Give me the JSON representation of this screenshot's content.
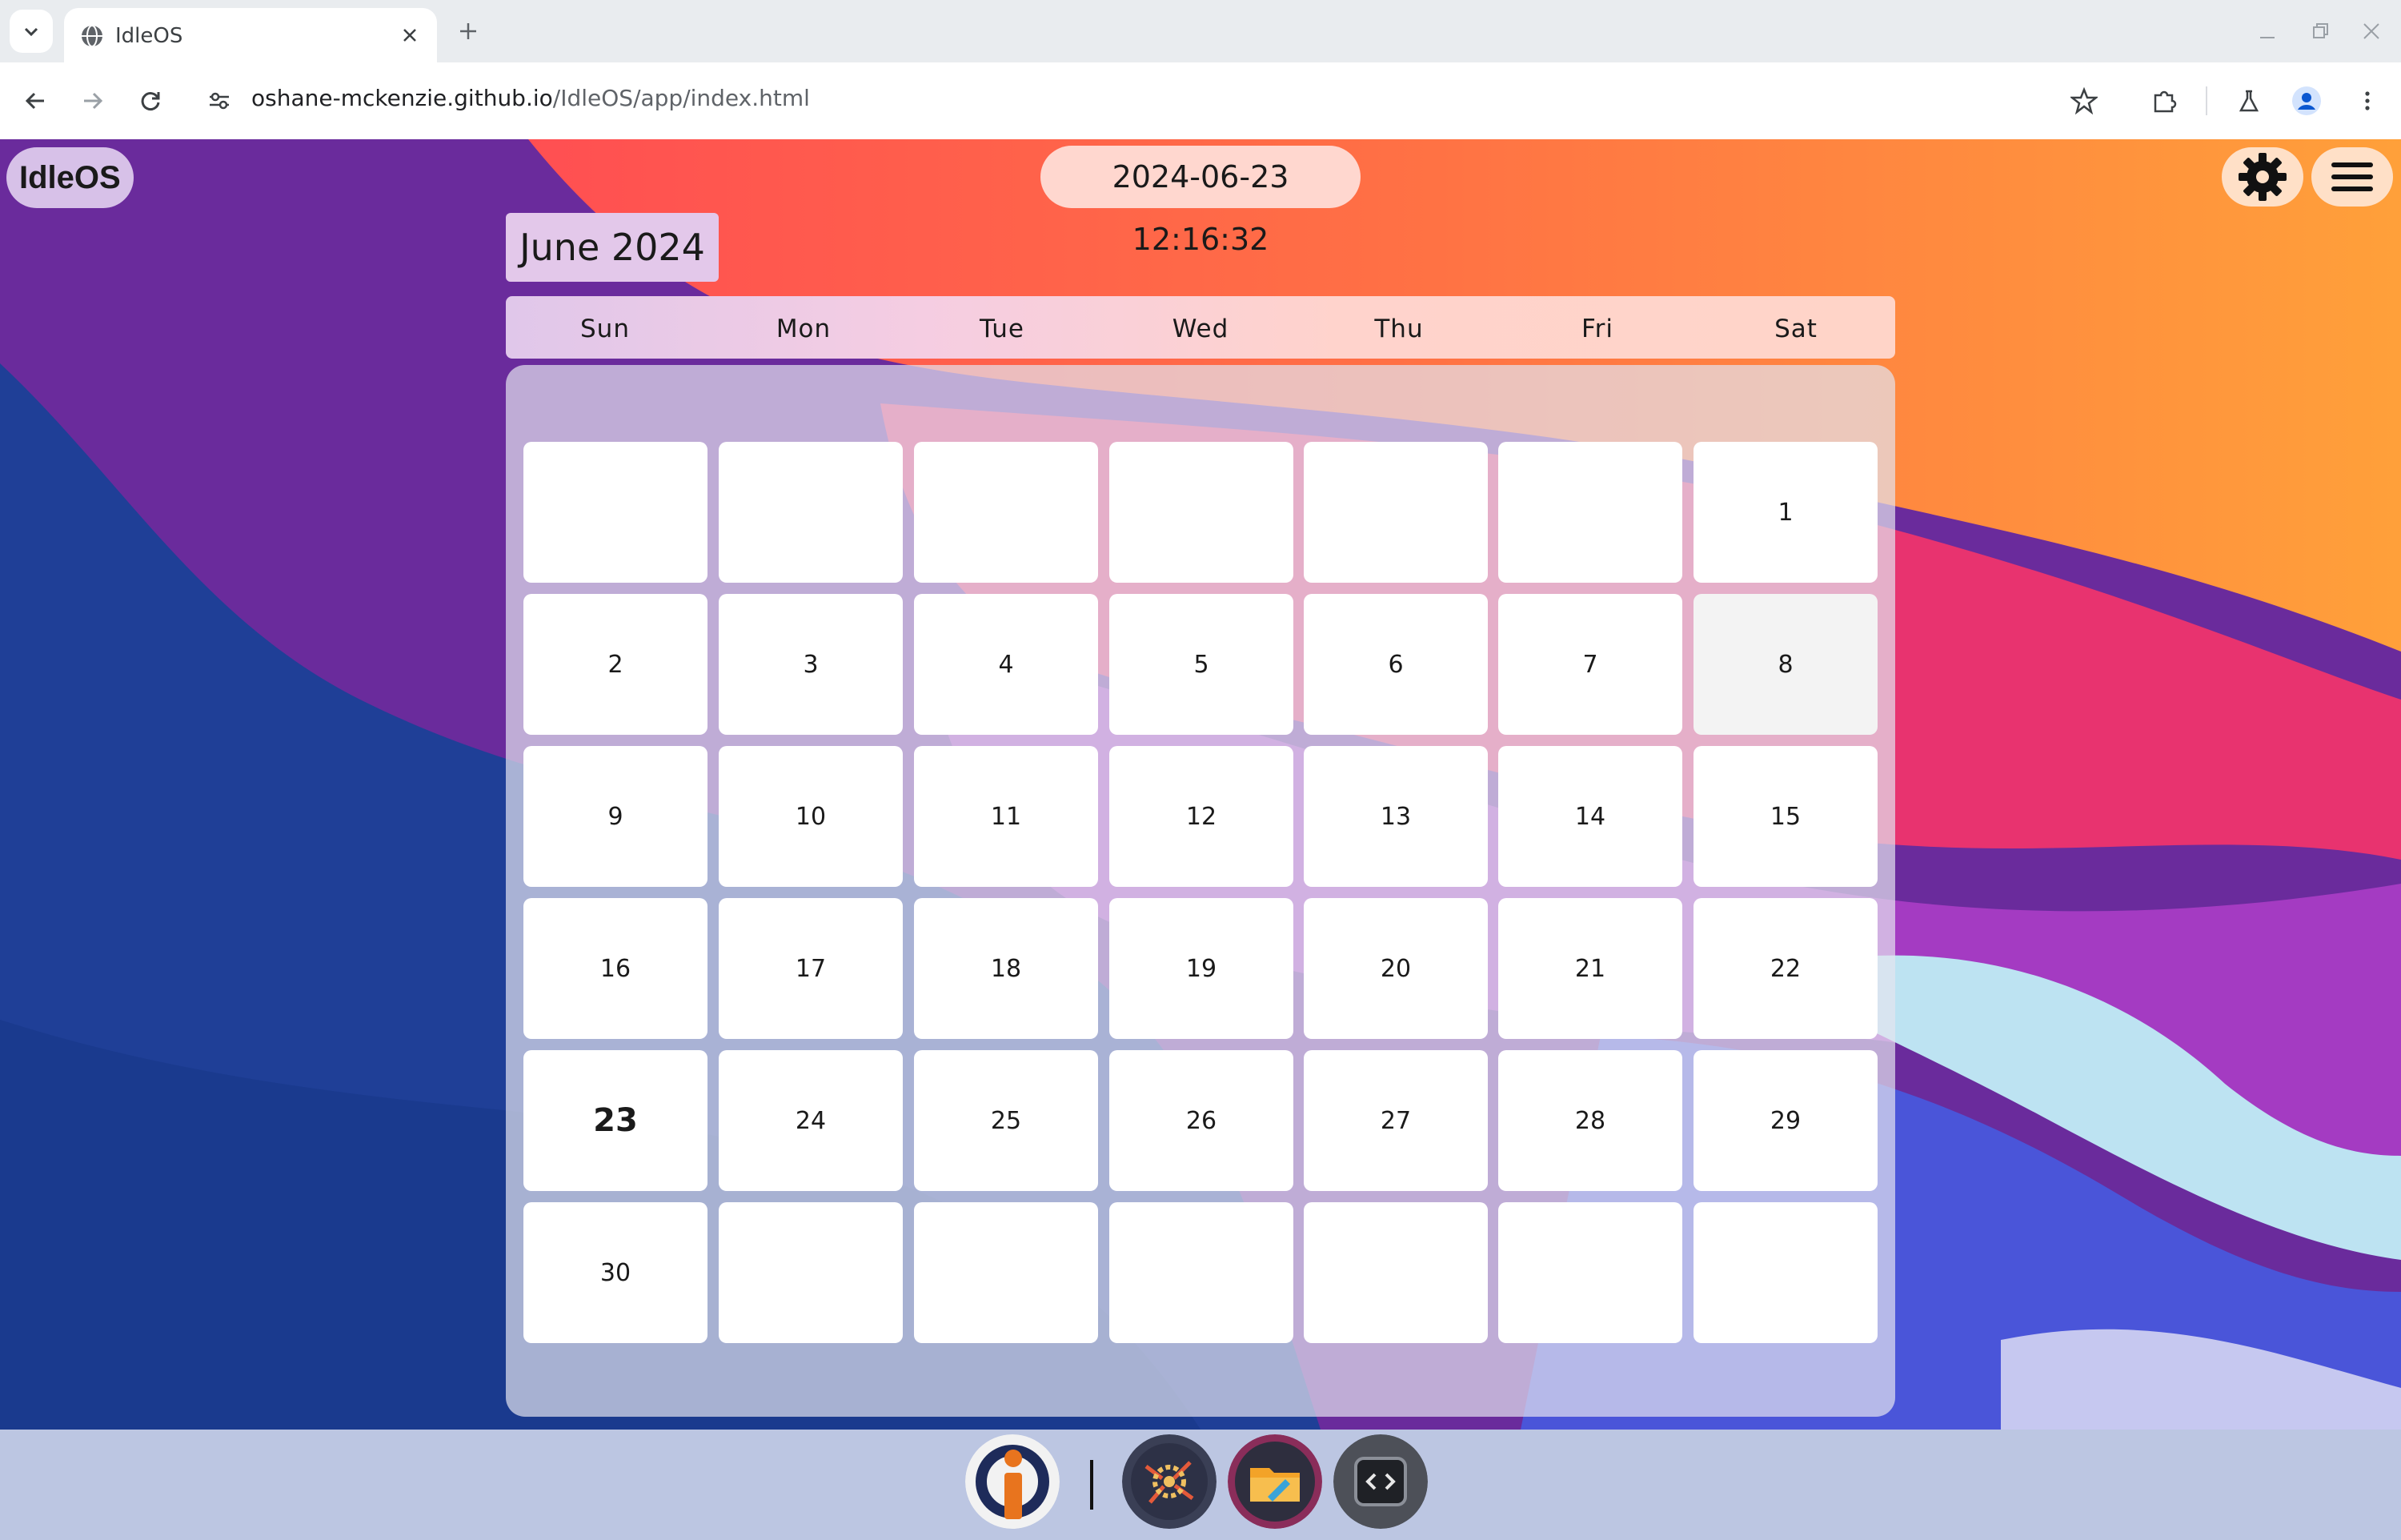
{
  "browser": {
    "tab_title": "IdleOS",
    "url_host": "oshane-mckenzie.github.io",
    "url_path": "/IdleOS/app/index.html"
  },
  "desktop": {
    "brand": "IdleOS",
    "clock": "2024-06-23 12:16:32"
  },
  "calendar": {
    "month_title": "June 2024",
    "weekdays": [
      "Sun",
      "Mon",
      "Tue",
      "Wed",
      "Thu",
      "Fri",
      "Sat"
    ],
    "weeks": [
      [
        "",
        "",
        "",
        "",
        "",
        "",
        "1"
      ],
      [
        "2",
        "3",
        "4",
        "5",
        "6",
        "7",
        "8"
      ],
      [
        "9",
        "10",
        "11",
        "12",
        "13",
        "14",
        "15"
      ],
      [
        "16",
        "17",
        "18",
        "19",
        "20",
        "21",
        "22"
      ],
      [
        "23",
        "24",
        "25",
        "26",
        "27",
        "28",
        "29"
      ],
      [
        "30",
        "",
        "",
        "",
        "",
        "",
        ""
      ]
    ],
    "today": "23",
    "hovered": "8"
  },
  "dock": {
    "apps": [
      "idleos-logo-icon",
      "settings-app-icon",
      "file-manager-icon",
      "code-editor-icon"
    ]
  },
  "colors": {
    "wall_purple": "#6b2a9a",
    "wall_blue": "#1f3a93",
    "wall_red": "#ff4a55",
    "wall_orange": "#ff8a3a",
    "wall_pink": "#e6326e",
    "wall_magenta": "#a53ac0"
  }
}
